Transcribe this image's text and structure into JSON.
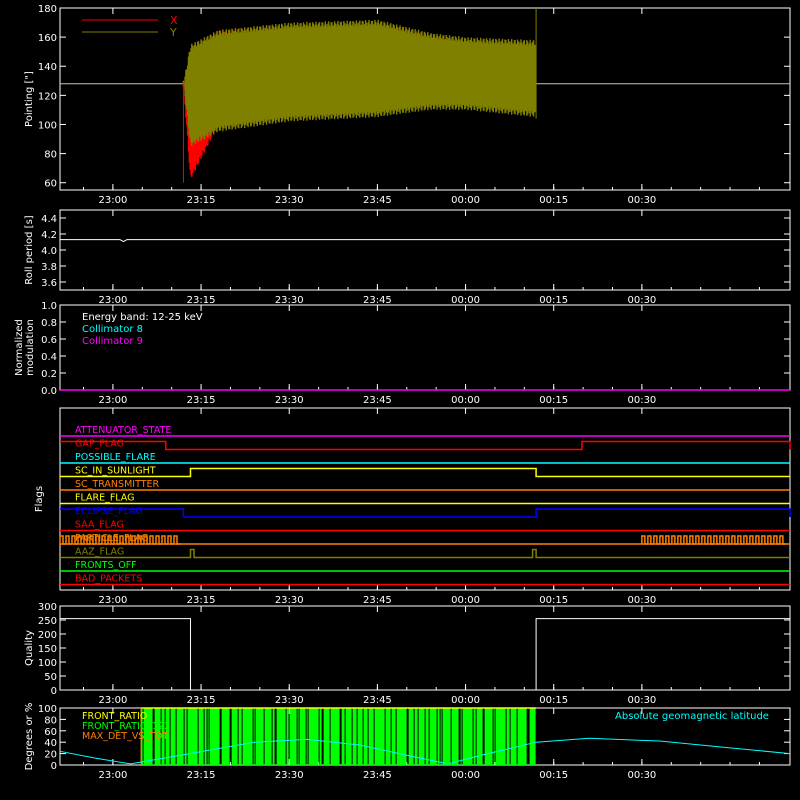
{
  "time_ticks": [
    "23:00",
    "23:15",
    "23:30",
    "23:45",
    "00:00",
    "00:15",
    "00:30"
  ],
  "colors": {
    "axes": "#ffffff",
    "x_series": "#ff0000",
    "y_series": "#808000",
    "cyan": "#00ffff",
    "magenta": "#ff00ff",
    "green": "#00ff00",
    "orange": "#ff8000",
    "yellow": "#ffff00",
    "blue": "#0000ff",
    "red": "#ff0000"
  },
  "chart_data": [
    {
      "type": "line",
      "ylabel": "Pointing [\"]",
      "ylim": [
        55,
        180
      ],
      "yticks": [
        60,
        80,
        100,
        120,
        140,
        160,
        180
      ],
      "legend": [
        {
          "name": "X",
          "color": "#ff0000"
        },
        {
          "name": "Y",
          "color": "#808000"
        }
      ],
      "reference_line": 128,
      "active_interval_hours": [
        23.2,
        24.2
      ],
      "series": [
        {
          "name": "X",
          "envelope_upper": [
            [
              23.2,
              128
            ],
            [
              23.22,
              150
            ],
            [
              23.3,
              165
            ],
            [
              23.5,
              168
            ],
            [
              23.75,
              170
            ],
            [
              23.9,
              162
            ],
            [
              24.0,
              158
            ],
            [
              24.2,
              156
            ]
          ],
          "envelope_lower": [
            [
              23.2,
              128
            ],
            [
              23.22,
              62
            ],
            [
              23.3,
              100
            ],
            [
              23.5,
              112
            ],
            [
              23.75,
              114
            ],
            [
              23.9,
              117
            ],
            [
              24.0,
              115
            ],
            [
              24.2,
              112
            ]
          ]
        },
        {
          "name": "Y",
          "envelope_upper": [
            [
              23.2,
              128
            ],
            [
              23.22,
              155
            ],
            [
              23.3,
              165
            ],
            [
              23.5,
              170
            ],
            [
              23.75,
              172
            ],
            [
              23.9,
              163
            ],
            [
              24.0,
              160
            ],
            [
              24.2,
              158
            ]
          ],
          "envelope_lower": [
            [
              23.2,
              128
            ],
            [
              23.22,
              85
            ],
            [
              23.3,
              95
            ],
            [
              23.5,
              102
            ],
            [
              23.75,
              105
            ],
            [
              23.9,
              110
            ],
            [
              24.0,
              110
            ],
            [
              24.2,
              105
            ]
          ]
        }
      ]
    },
    {
      "type": "line",
      "ylabel": "Roll period [s]",
      "ylim": [
        3.5,
        4.5
      ],
      "yticks": [
        3.6,
        3.8,
        4.0,
        4.2,
        4.4
      ],
      "value": 4.13
    },
    {
      "type": "line",
      "ylabel": "Normalized modulation",
      "ylim": [
        0,
        1
      ],
      "yticks": [
        0.0,
        0.2,
        0.4,
        0.6,
        0.8,
        1.0
      ],
      "legend": [
        {
          "name": "Energy band: 12-25 keV",
          "color": "#ffffff"
        },
        {
          "name": "Collimator 8",
          "color": "#00ffff"
        },
        {
          "name": "Collimator 9",
          "color": "#ff00ff"
        }
      ],
      "value": 0.0
    },
    {
      "type": "line",
      "ylabel": "Flags",
      "flags": [
        {
          "name": "ATTENUATOR_STATE",
          "color": "#ff00ff",
          "on": []
        },
        {
          "name": "GAP_FLAG",
          "color": "#ff0000",
          "on": [
            [
              22.85,
              23.15
            ],
            [
              24.33,
              24.92
            ]
          ]
        },
        {
          "name": "POSSIBLE_FLARE",
          "color": "#00ffff",
          "on": []
        },
        {
          "name": "SC_IN_SUNLIGHT",
          "color": "#ffff00",
          "on": [
            [
              23.22,
              24.2
            ]
          ]
        },
        {
          "name": "SC_TRANSMITTER",
          "color": "#ff8000",
          "on": []
        },
        {
          "name": "FLARE_FLAG",
          "color": "#ffff00",
          "on": []
        },
        {
          "name": "ECLIPSE_FLAG",
          "color": "#0000ff",
          "on": [
            [
              22.85,
              23.2
            ],
            [
              24.2,
              24.92
            ]
          ]
        },
        {
          "name": "SAA_FLAG",
          "color": "#ff0000",
          "on": []
        },
        {
          "name": "PARTICLE_FLAG",
          "color": "#ff8000",
          "on": [
            [
              22.85,
              23.2
            ],
            [
              24.5,
              24.92
            ]
          ]
        },
        {
          "name": "AAZ_FLAG",
          "color": "#808000",
          "on": [
            [
              23.22,
              23.23
            ],
            [
              24.19,
              24.2
            ]
          ]
        },
        {
          "name": "FRONTS_OFF",
          "color": "#00ff00",
          "on": []
        },
        {
          "name": "BAD_PACKETS",
          "color": "#ff0000",
          "on": []
        }
      ]
    },
    {
      "type": "line",
      "ylabel": "Quality",
      "ylim": [
        0,
        300
      ],
      "yticks": [
        0,
        50,
        100,
        150,
        200,
        250,
        300
      ],
      "segments": [
        {
          "x": [
            22.85,
            23.22
          ],
          "y": 255
        },
        {
          "x": [
            23.22,
            24.2
          ],
          "y": 0
        },
        {
          "x": [
            24.2,
            24.92
          ],
          "y": 255
        }
      ]
    },
    {
      "type": "line",
      "ylabel": "Degrees or %",
      "ylim": [
        0,
        100
      ],
      "yticks": [
        0,
        20,
        40,
        60,
        80,
        100
      ],
      "legend": [
        {
          "name": "FRONT_RATIO",
          "color": "#ffff00"
        },
        {
          "name": "FRONT_RATIO_1225",
          "color": "#00ff00"
        },
        {
          "name": "MAX_DET_VS_TOT",
          "color": "#ff8000"
        },
        {
          "name": "Absolute geomagnetic latitude",
          "color": "#00ffff"
        }
      ],
      "front_ratio_band_hours": [
        23.08,
        24.2
      ],
      "geomagnetic_latitude": [
        [
          22.85,
          24
        ],
        [
          22.95,
          12
        ],
        [
          23.05,
          2
        ],
        [
          23.2,
          18
        ],
        [
          23.4,
          40
        ],
        [
          23.55,
          45
        ],
        [
          23.7,
          35
        ],
        [
          23.85,
          15
        ],
        [
          23.95,
          2
        ],
        [
          24.05,
          18
        ],
        [
          24.2,
          40
        ],
        [
          24.35,
          47
        ],
        [
          24.55,
          42
        ],
        [
          24.75,
          30
        ],
        [
          24.92,
          20
        ]
      ]
    }
  ]
}
